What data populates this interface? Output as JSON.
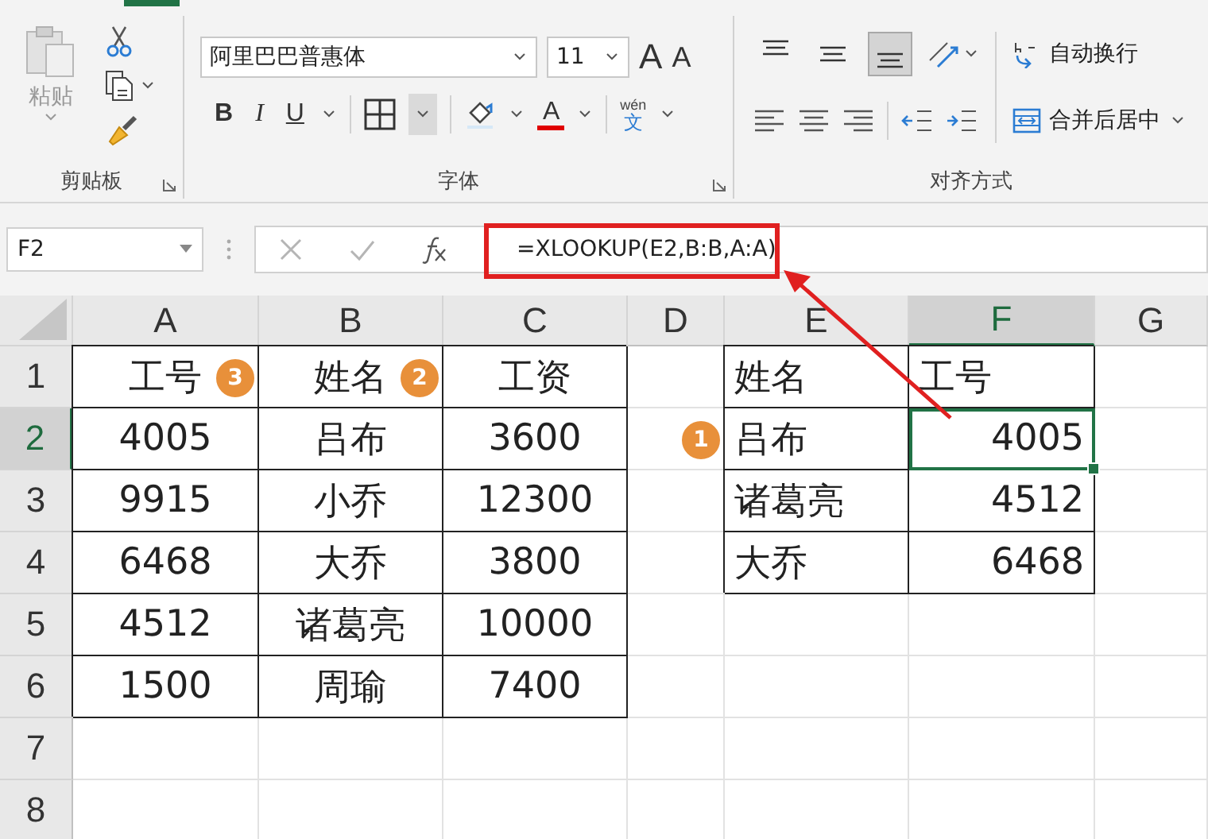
{
  "ribbon": {
    "clipboard": {
      "paste_label": "粘贴",
      "group_label": "剪贴板"
    },
    "font": {
      "font_name": "阿里巴巴普惠体",
      "font_size": "11",
      "grow_label": "A",
      "shrink_label": "A",
      "bold_label": "B",
      "italic_label": "I",
      "underline_label": "U",
      "font_color_label": "A",
      "phonetic_label": "wén",
      "phonetic_char": "文",
      "group_label": "字体"
    },
    "alignment": {
      "vertical_align": [
        {
          "selected": false
        },
        {
          "selected": false
        },
        {
          "selected": true
        }
      ],
      "wrap_text": "自动换行",
      "merge_center": "合并后居中",
      "group_label": "对齐方式"
    }
  },
  "formula_bar": {
    "name_box": "F2",
    "formula": "=XLOOKUP(E2,B:B,A:A)"
  },
  "columns": [
    {
      "label": "A",
      "selected": false
    },
    {
      "label": "B",
      "selected": false
    },
    {
      "label": "C",
      "selected": false
    },
    {
      "label": "D",
      "selected": false
    },
    {
      "label": "E",
      "selected": false
    },
    {
      "label": "F",
      "selected": true
    },
    {
      "label": "G",
      "selected": false
    }
  ],
  "rows": [
    {
      "number": "1",
      "selected": false,
      "cells": [
        {
          "text": "工号",
          "badge": "3",
          "selected": false
        },
        {
          "text": "姓名",
          "badge": "2",
          "selected": false
        },
        {
          "text": "工资",
          "selected": false
        },
        {
          "selected": false
        },
        {
          "text": "姓名",
          "selected": false
        },
        {
          "text": "工号",
          "selected": false
        },
        {
          "selected": false
        }
      ]
    },
    {
      "number": "2",
      "selected": true,
      "cells": [
        {
          "text": "4005",
          "selected": false
        },
        {
          "text": "吕布",
          "selected": false
        },
        {
          "text": "3600",
          "selected": false
        },
        {
          "badge": "1",
          "selected": false
        },
        {
          "text": "吕布",
          "selected": false
        },
        {
          "text": "4005",
          "selected": true
        },
        {
          "selected": false
        }
      ]
    },
    {
      "number": "3",
      "selected": false,
      "cells": [
        {
          "text": "9915",
          "selected": false
        },
        {
          "text": "小乔",
          "selected": false
        },
        {
          "text": "12300",
          "selected": false
        },
        {
          "selected": false
        },
        {
          "text": "诸葛亮",
          "selected": false
        },
        {
          "text": "4512",
          "selected": false
        },
        {
          "selected": false
        }
      ]
    },
    {
      "number": "4",
      "selected": false,
      "cells": [
        {
          "text": "6468",
          "selected": false
        },
        {
          "text": "大乔",
          "selected": false
        },
        {
          "text": "3800",
          "selected": false
        },
        {
          "selected": false
        },
        {
          "text": "大乔",
          "selected": false
        },
        {
          "text": "6468",
          "selected": false
        },
        {
          "selected": false
        }
      ]
    },
    {
      "number": "5",
      "selected": false,
      "cells": [
        {
          "text": "4512",
          "selected": false
        },
        {
          "text": "诸葛亮",
          "selected": false
        },
        {
          "text": "10000",
          "selected": false
        },
        {
          "selected": false
        },
        {
          "selected": false
        },
        {
          "selected": false
        },
        {
          "selected": false
        }
      ]
    },
    {
      "number": "6",
      "selected": false,
      "cells": [
        {
          "text": "1500",
          "selected": false
        },
        {
          "text": "周瑜",
          "selected": false
        },
        {
          "text": "7400",
          "selected": false
        },
        {
          "selected": false
        },
        {
          "selected": false
        },
        {
          "selected": false
        },
        {
          "selected": false
        }
      ]
    },
    {
      "number": "7",
      "selected": false,
      "cells": [
        {
          "selected": false
        },
        {
          "selected": false
        },
        {
          "selected": false
        },
        {
          "selected": false
        },
        {
          "selected": false
        },
        {
          "selected": false
        },
        {
          "selected": false
        }
      ]
    },
    {
      "number": "8",
      "selected": false,
      "cells": [
        {
          "selected": false
        },
        {
          "selected": false
        },
        {
          "selected": false
        },
        {
          "selected": false
        },
        {
          "selected": false
        },
        {
          "selected": false
        },
        {
          "selected": false
        }
      ]
    }
  ]
}
